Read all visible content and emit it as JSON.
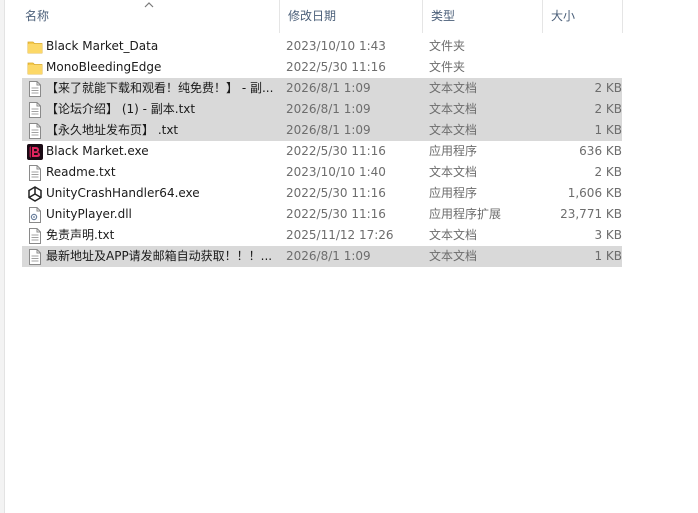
{
  "columns": {
    "name": "名称",
    "date": "修改日期",
    "type": "类型",
    "size": "大小"
  },
  "files": [
    {
      "name": "Black Market_Data",
      "date": "2023/10/10 1:43",
      "type": "文件夹",
      "size": "",
      "icon": "folder-icon",
      "selected": false
    },
    {
      "name": "MonoBleedingEdge",
      "date": "2022/5/30 11:16",
      "type": "文件夹",
      "size": "",
      "icon": "folder-icon",
      "selected": false
    },
    {
      "name": "【来了就能下载和观看！纯免费！】 - 副...",
      "date": "2026/8/1 1:09",
      "type": "文本文档",
      "size": "2 KB",
      "icon": "text-file-icon",
      "selected": true
    },
    {
      "name": "【论坛介绍】 (1) - 副本.txt",
      "date": "2026/8/1 1:09",
      "type": "文本文档",
      "size": "2 KB",
      "icon": "text-file-icon",
      "selected": true
    },
    {
      "name": "【永久地址发布页】 .txt",
      "date": "2026/8/1 1:09",
      "type": "文本文档",
      "size": "1 KB",
      "icon": "text-file-icon",
      "selected": true
    },
    {
      "name": "Black Market.exe",
      "date": "2022/5/30 11:16",
      "type": "应用程序",
      "size": "636 KB",
      "icon": "app-logo-icon",
      "selected": false
    },
    {
      "name": "Readme.txt",
      "date": "2023/10/10 1:40",
      "type": "文本文档",
      "size": "2 KB",
      "icon": "text-file-icon",
      "selected": false
    },
    {
      "name": "UnityCrashHandler64.exe",
      "date": "2022/5/30 11:16",
      "type": "应用程序",
      "size": "1,606 KB",
      "icon": "unity-icon",
      "selected": false
    },
    {
      "name": "UnityPlayer.dll",
      "date": "2022/5/30 11:16",
      "type": "应用程序扩展",
      "size": "23,771 KB",
      "icon": "dll-file-icon",
      "selected": false
    },
    {
      "name": "免责声明.txt",
      "date": "2025/11/12 17:26",
      "type": "文本文档",
      "size": "3 KB",
      "icon": "text-file-icon",
      "selected": false
    },
    {
      "name": "最新地址及APP请发邮箱自动获取！！！...",
      "date": "2026/8/1 1:09",
      "type": "文本文档",
      "size": "1 KB",
      "icon": "text-file-icon",
      "selected": true
    }
  ],
  "colors": {
    "selection": "#d9d9d9",
    "folder": "#f5c94a",
    "header_text": "#4c607a"
  }
}
